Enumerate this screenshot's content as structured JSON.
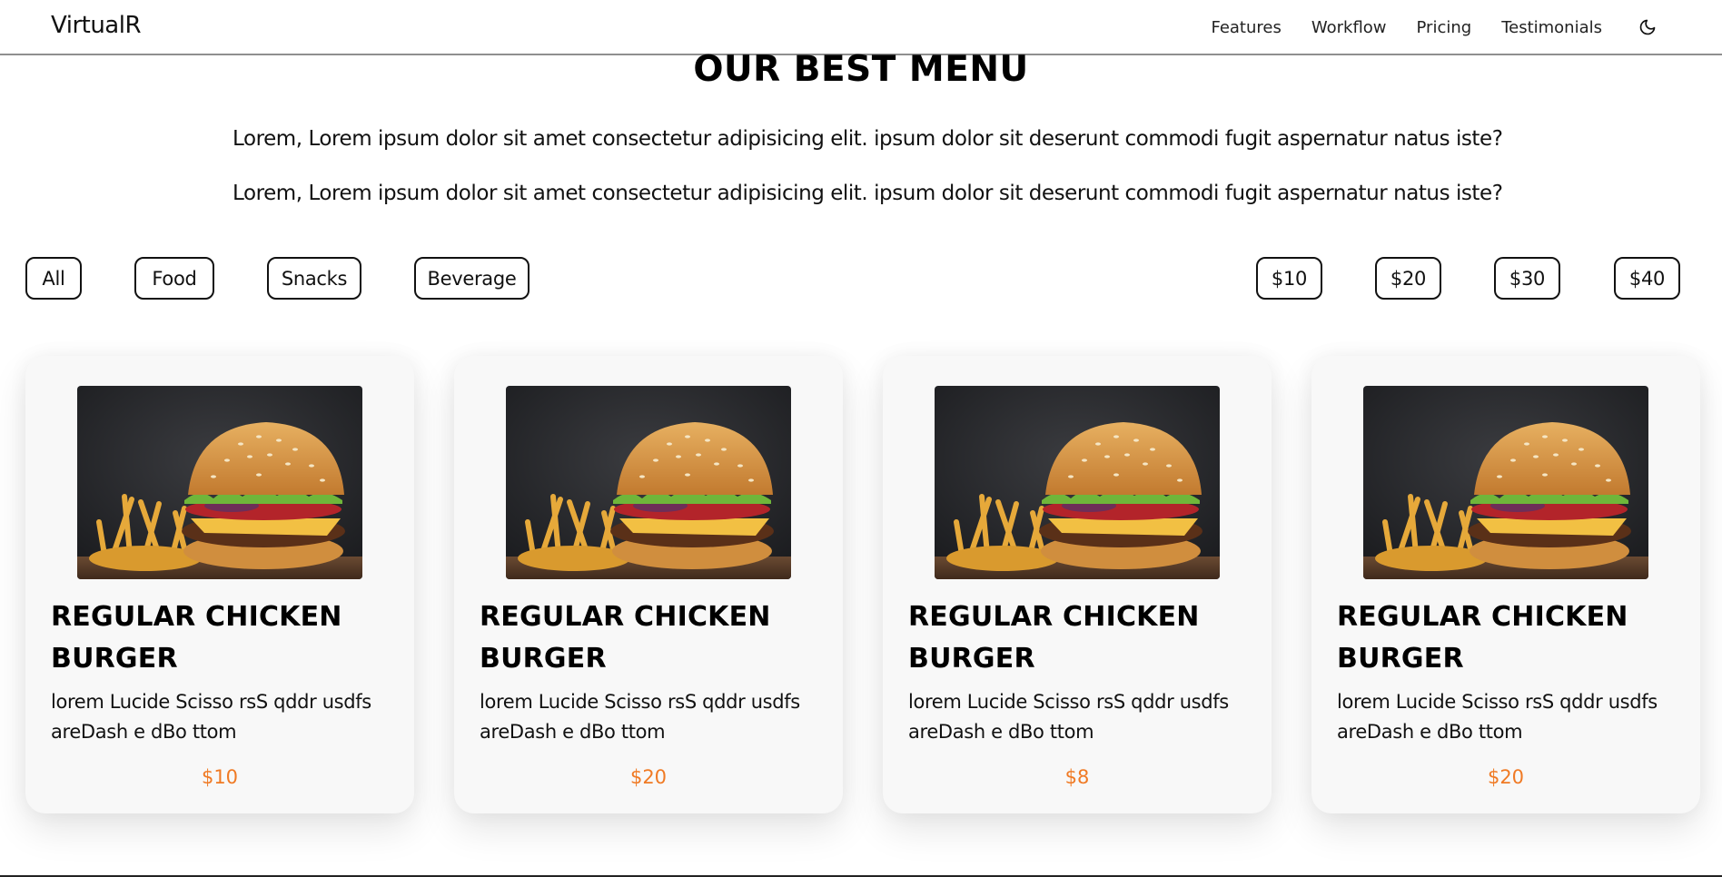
{
  "navbar": {
    "brand": "VirtualR",
    "links": [
      "Features",
      "Workflow",
      "Pricing",
      "Testimonials"
    ],
    "theme_icon": "moon-icon"
  },
  "menu": {
    "title": "OUR BEST MENU",
    "paragraphs": [
      "Lorem, Lorem ipsum dolor sit amet consectetur adipisicing elit. ipsum dolor sit deserunt commodi fugit aspernatur natus iste?",
      "Lorem, Lorem ipsum dolor sit amet consectetur adipisicing elit. ipsum dolor sit deserunt commodi fugit aspernatur natus iste?"
    ],
    "category_filters": [
      "All",
      "Food",
      "Snacks",
      "Beverage"
    ],
    "price_filters": [
      "$10",
      "$20",
      "$30",
      "$40"
    ],
    "items": [
      {
        "title": "REGULAR CHICKEN BURGER",
        "description": "lorem Lucide Scisso rsS qddr usdfs areDash e dBo ttom",
        "price": "$10"
      },
      {
        "title": "REGULAR CHICKEN BURGER",
        "description": "lorem Lucide Scisso rsS qddr usdfs areDash e dBo ttom",
        "price": "$20"
      },
      {
        "title": "REGULAR CHICKEN BURGER",
        "description": "lorem Lucide Scisso rsS qddr usdfs areDash e dBo ttom",
        "price": "$8"
      },
      {
        "title": "REGULAR CHICKEN BURGER",
        "description": "lorem Lucide Scisso rsS qddr usdfs areDash e dBo ttom",
        "price": "$20"
      }
    ]
  },
  "colors": {
    "price": "#f07a24",
    "chip_border": "#111111",
    "card_background": "#f8f8f8"
  }
}
